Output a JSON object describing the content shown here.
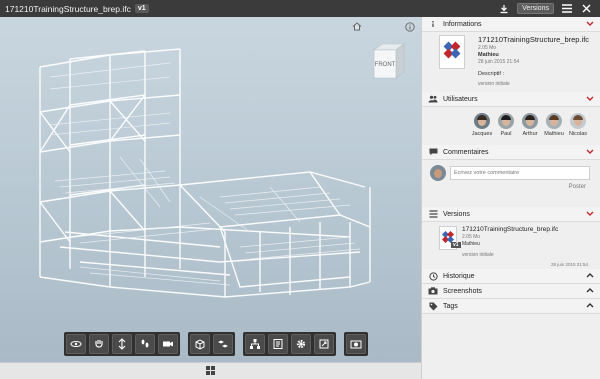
{
  "header": {
    "file_title": "171210TrainingStructure_brep.ifc",
    "version_badge": "v1",
    "versions_button": "Versions",
    "icons": [
      "download-icon",
      "menu-icon",
      "close-icon"
    ]
  },
  "viewer": {
    "view_cube_label": "FRONT",
    "icons": [
      "home-icon",
      "info-icon"
    ],
    "toolbar_groups": [
      [
        "orbit-icon",
        "pan-hand-icon",
        "zoom-icon",
        "walk-icon",
        "camera-icon"
      ],
      [
        "section-box-icon",
        "explode-icon"
      ],
      [
        "model-tree-icon",
        "properties-icon",
        "settings-icon",
        "fullscreen-icon"
      ],
      [
        "screenshot-icon"
      ]
    ],
    "bottom_icon": "grid-icon"
  },
  "panel": {
    "informations": {
      "title": "Informations",
      "file_name": "171210TrainingStructure_brep.ifc",
      "size": "2.05 Mo",
      "author": "Mathieu",
      "date": "28 juin 2015 21:54",
      "description_label": "Descriptif :",
      "description": "version initiale"
    },
    "users": {
      "title": "Utilisateurs",
      "list": [
        {
          "name": "Jacques",
          "bg": "#6d7d88",
          "hair": "#3a2a20"
        },
        {
          "name": "Paul",
          "bg": "#9aa3a8",
          "hair": "#1c1c1c"
        },
        {
          "name": "Arthur",
          "bg": "#8c9aa4",
          "hair": "#2e231b"
        },
        {
          "name": "Mathieu",
          "bg": "#a5b0b7",
          "hair": "#5a3a22"
        },
        {
          "name": "Nicolas",
          "bg": "#c3cbd0",
          "hair": "#6b4c33"
        }
      ]
    },
    "comments": {
      "title": "Commentaires",
      "placeholder": "Ecrivez votre commentaire",
      "post_label": "Poster"
    },
    "versions": {
      "title": "Versions",
      "file_name": "171210TrainingStructure_brep.ifc",
      "size": "2.05 Mo",
      "author": "Mathieu",
      "badge": "v1",
      "description": "version initiale",
      "date": "28 juin 2015 21:54"
    },
    "historique": {
      "title": "Historique"
    },
    "screenshots": {
      "title": "Screenshots"
    },
    "tags": {
      "title": "Tags"
    }
  },
  "colors": {
    "accent": "#c0282d",
    "header_bg": "#3b3b3b",
    "panel_bg": "#efefef",
    "viewer_top": "#c9d6df",
    "viewer_bottom": "#a9bac6"
  }
}
